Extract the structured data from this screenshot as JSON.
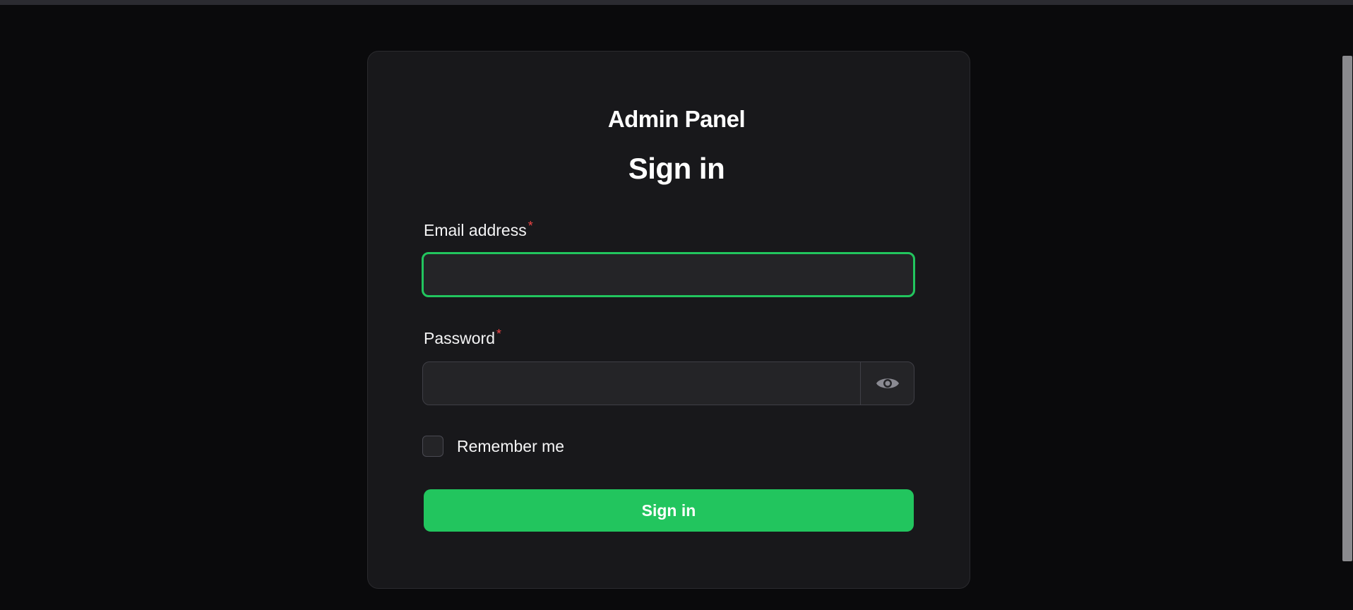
{
  "app": {
    "brand": "Admin Panel",
    "heading": "Sign in"
  },
  "form": {
    "email": {
      "label": "Email address",
      "required_marker": "*",
      "value": "",
      "placeholder": ""
    },
    "password": {
      "label": "Password",
      "required_marker": "*",
      "value": "",
      "placeholder": "",
      "toggle_icon": "eye-icon"
    },
    "remember": {
      "label": "Remember me",
      "checked": false
    },
    "submit_label": "Sign in"
  },
  "colors": {
    "background": "#0a0a0c",
    "card": "#18181b",
    "accent": "#22c55e",
    "required": "#ef4444"
  }
}
